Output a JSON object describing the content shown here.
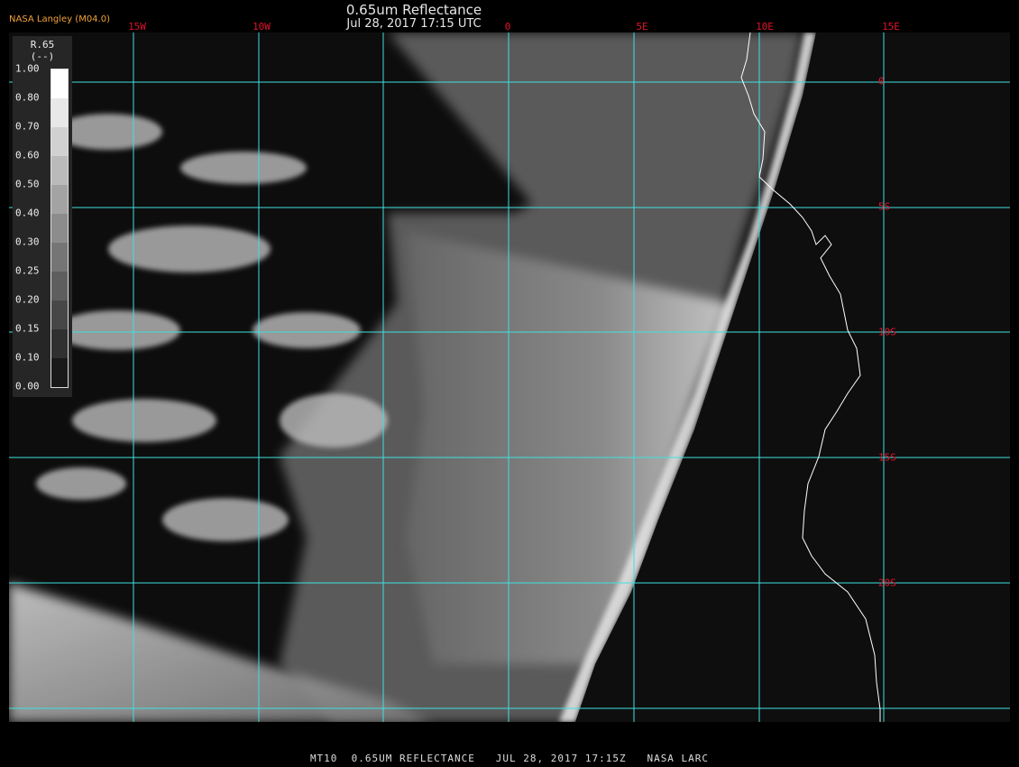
{
  "header": {
    "title": "0.65um Reflectance",
    "datetime": "Jul 28, 2017 17:15 UTC",
    "brand": "NASA Langley (M04.0)"
  },
  "longitude_labels": [
    "15W",
    "10W",
    "0",
    "5E",
    "10E",
    "15E"
  ],
  "latitude_labels": [
    "0",
    "5S",
    "10S",
    "15S",
    "20S"
  ],
  "colorbar": {
    "title_line1": "R.65",
    "title_line2": "(--)",
    "ticks": [
      "1.00",
      "0.80",
      "0.70",
      "0.60",
      "0.50",
      "0.40",
      "0.30",
      "0.25",
      "0.20",
      "0.15",
      "0.10",
      "0.00"
    ]
  },
  "footer": {
    "text": "MT10  0.65UM REFLECTANCE   JUL 28, 2017 17:15Z   NASA LARC"
  },
  "colors": {
    "grid": "#40e0e0",
    "labels": "#e0142a",
    "brand": "#f2a23a",
    "coastline": "#ffffff"
  }
}
